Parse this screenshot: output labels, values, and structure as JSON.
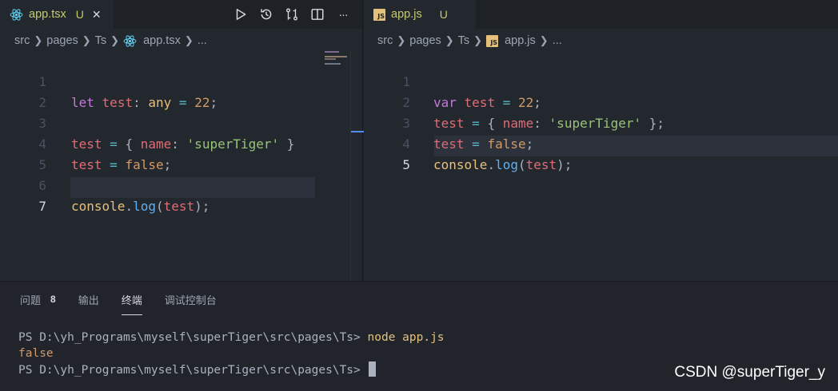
{
  "left_editor": {
    "tab": {
      "label": "app.tsx",
      "status": "U",
      "close": "✕",
      "icon": "react-icon"
    },
    "toolbar": {
      "icons": [
        "run-icon",
        "history-icon",
        "compare-icon",
        "split-editor-icon",
        "more-icon"
      ],
      "more_label": "···"
    },
    "breadcrumb": [
      "src",
      "pages",
      "Ts",
      "app.tsx",
      "..."
    ],
    "line_numbers": [
      "1",
      "2",
      "3",
      "4",
      "5",
      "6",
      "7"
    ],
    "active_line": "7",
    "code": {
      "l1": {
        "kw": "let",
        "var": "test",
        "colon": ":",
        "type": "any",
        "eq": "=",
        "num": "22",
        "semi": ";"
      },
      "l3": {
        "var": "test",
        "eq": "=",
        "open": "{",
        "key": "name",
        "colon": ":",
        "str": "'superTiger'",
        "close": "}"
      },
      "l4": {
        "var": "test",
        "eq": "=",
        "val": "false",
        "semi": ";"
      },
      "l6": {
        "obj": "console",
        "dot": ".",
        "fn": "log",
        "open": "(",
        "arg": "test",
        "close": ")",
        "semi": ";"
      }
    }
  },
  "right_editor": {
    "tab": {
      "label": "app.js",
      "status": "U",
      "icon": "js-icon",
      "icon_text": "JS"
    },
    "breadcrumb": [
      "src",
      "pages",
      "Ts",
      "app.js",
      "..."
    ],
    "line_numbers": [
      "1",
      "2",
      "3",
      "4",
      "5"
    ],
    "active_line": "5",
    "code": {
      "l1": {
        "kw": "var",
        "var": "test",
        "eq": "=",
        "num": "22",
        "semi": ";"
      },
      "l2": {
        "var": "test",
        "eq": "=",
        "open": "{",
        "key": "name",
        "colon": ":",
        "str": "'superTiger'",
        "close": "};"
      },
      "l3": {
        "var": "test",
        "eq": "=",
        "val": "false",
        "semi": ";"
      },
      "l4": {
        "obj": "console",
        "dot": ".",
        "fn": "log",
        "open": "(",
        "arg": "test",
        "close": ")",
        "semi": ";"
      }
    }
  },
  "panel": {
    "tabs": [
      {
        "label": "问题",
        "badge": "8"
      },
      {
        "label": "输出"
      },
      {
        "label": "终端",
        "active": true
      },
      {
        "label": "调试控制台"
      }
    ],
    "terminal": {
      "prompt": "PS D:\\yh_Programs\\myself\\superTiger\\src\\pages\\Ts>",
      "command": "node app.js",
      "output": "false"
    }
  },
  "watermark": "CSDN @superTiger_y"
}
